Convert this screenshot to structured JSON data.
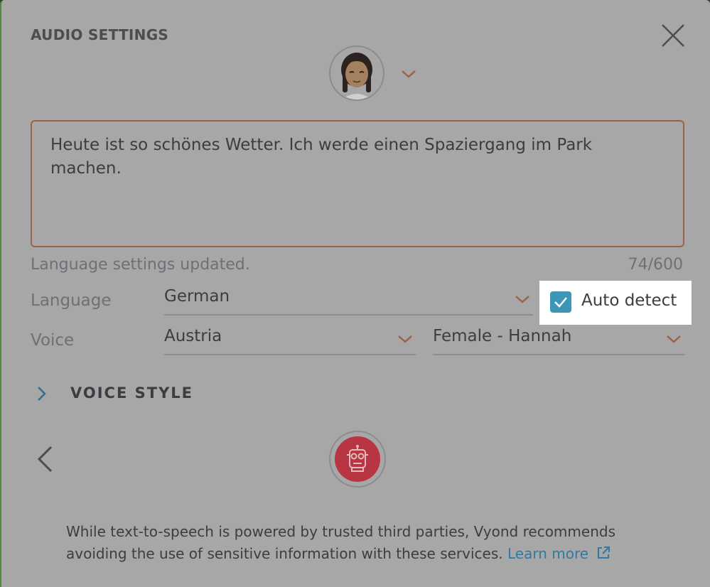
{
  "dialog": {
    "title": "AUDIO SETTINGS",
    "close_icon": "close-icon"
  },
  "character": {
    "avatar": "character-avatar",
    "dropdown_icon": "chevron-down-icon"
  },
  "script": {
    "text": "Heute ist so schönes Wetter. Ich werde einen Spaziergang im Park machen."
  },
  "status": {
    "message": "Language settings updated.",
    "char_count": "74/600"
  },
  "language": {
    "label": "Language",
    "selected": "German"
  },
  "auto_detect": {
    "label": "Auto detect",
    "checked": true
  },
  "voice": {
    "label": "Voice",
    "region": "Austria",
    "speaker": "Female - Hannah"
  },
  "voice_style": {
    "label": "VOICE STYLE"
  },
  "disclaimer": {
    "text": "While text-to-speech is powered by trusted third parties, Vyond recommends avoiding the use of sensitive information with these services.",
    "link": "Learn more"
  },
  "colors": {
    "accent": "#9a6347",
    "checkbox": "#3d95b8",
    "robot": "#b83544",
    "link": "#2f7aa4"
  }
}
